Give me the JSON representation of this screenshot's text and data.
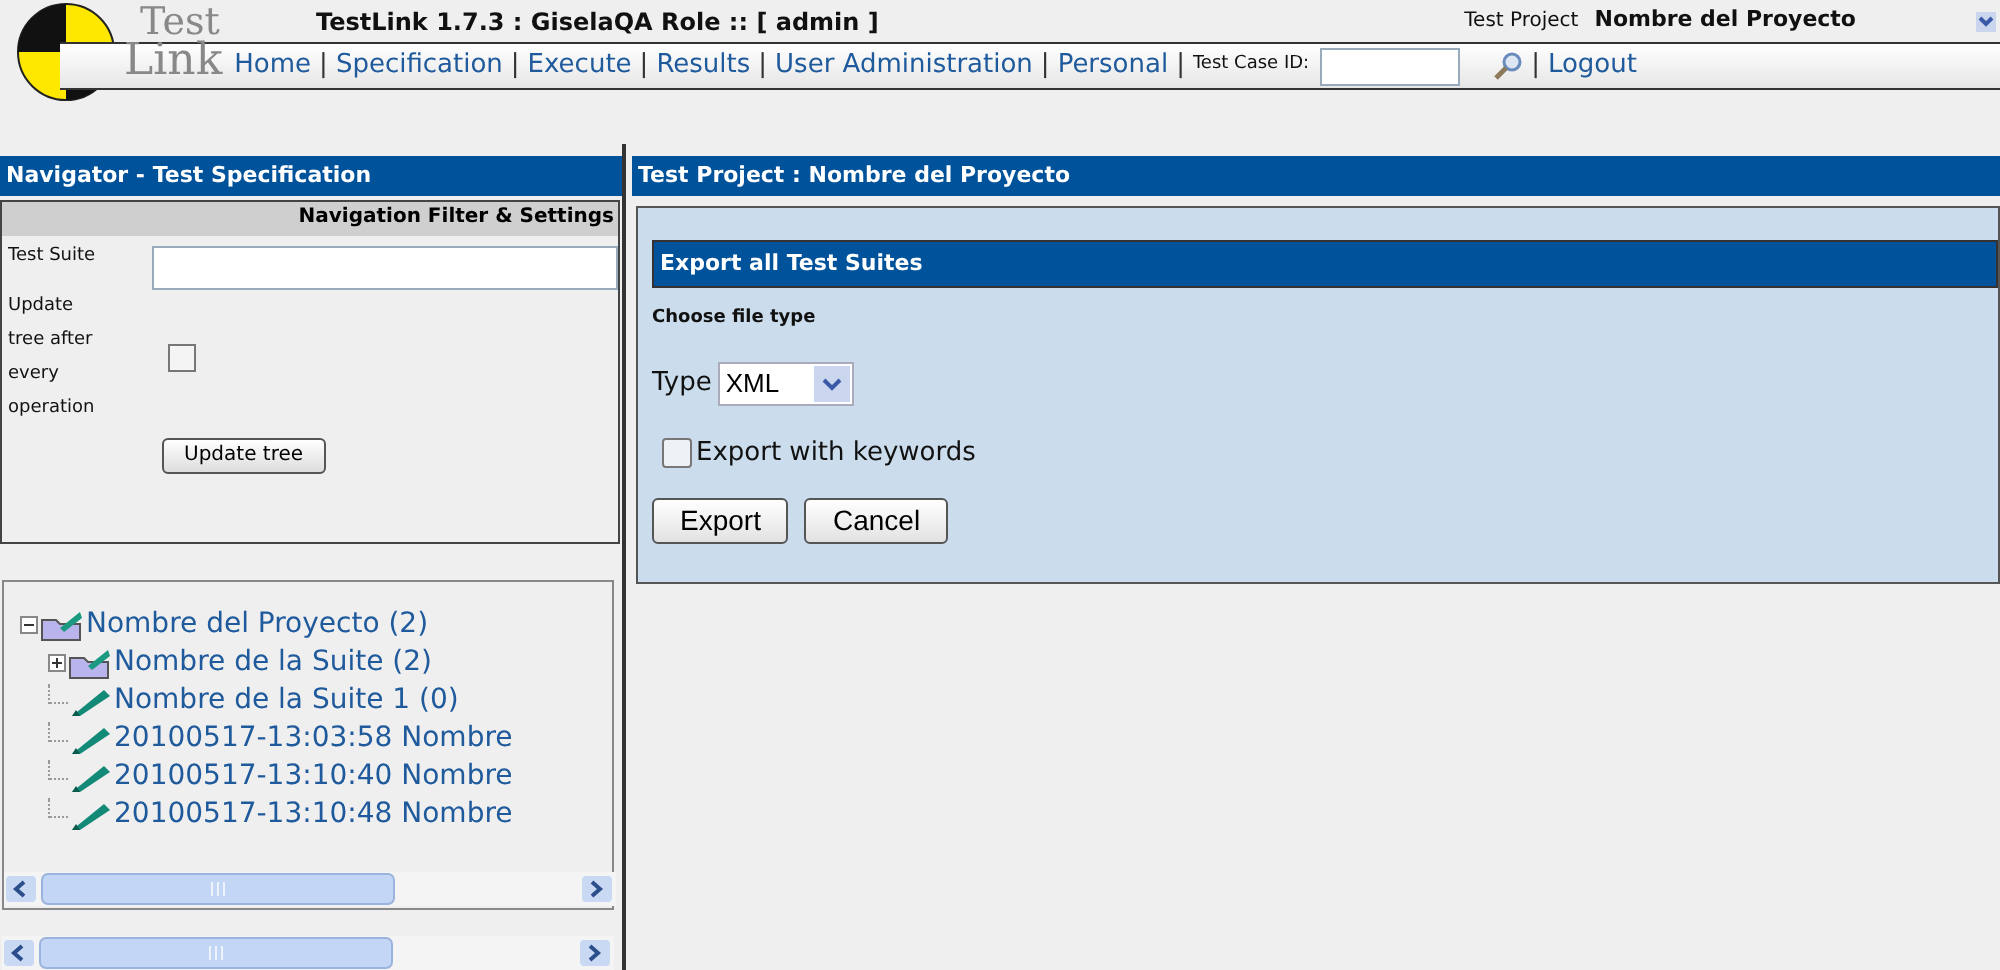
{
  "logo": {
    "top": "Test",
    "bottom": "Link"
  },
  "header": {
    "title": "TestLink 1.7.3 : GiselaQA Role :: [ admin ]",
    "project_label": "Test Project",
    "project_name": "Nombre del Proyecto"
  },
  "nav": [
    {
      "kind": "link",
      "label": "Home"
    },
    {
      "kind": "sep",
      "label": "|"
    },
    {
      "kind": "link",
      "label": "Specification"
    },
    {
      "kind": "sep",
      "label": "|"
    },
    {
      "kind": "link",
      "label": "Execute"
    },
    {
      "kind": "sep",
      "label": "|"
    },
    {
      "kind": "link",
      "label": "Results"
    },
    {
      "kind": "sep",
      "label": "|"
    },
    {
      "kind": "link",
      "label": "User Administration"
    },
    {
      "kind": "sep",
      "label": "|"
    },
    {
      "kind": "link",
      "label": "Personal"
    },
    {
      "kind": "sep",
      "label": "|"
    },
    {
      "kind": "label",
      "label": "Test Case ID:"
    },
    {
      "kind": "field"
    },
    {
      "kind": "search"
    },
    {
      "kind": "sep",
      "label": "|"
    },
    {
      "kind": "link",
      "label": "Logout"
    }
  ],
  "navigator": {
    "title": "Navigator - Test Specification",
    "filter_title": "Navigation Filter & Settings",
    "suite_label": "Test Suite",
    "update_label": "Update tree after every operation",
    "update_checked": false,
    "button": "Update tree",
    "tree": [
      {
        "label": "Nombre del Proyecto (2)",
        "kind": "project",
        "expanded": true,
        "children": [
          {
            "label": "Nombre de la Suite (2)",
            "kind": "suite",
            "expanded": false
          },
          {
            "label": "Nombre de la Suite 1 (0)",
            "kind": "case"
          },
          {
            "label": "20100517-13:03:58 Nombre",
            "kind": "case"
          },
          {
            "label": "20100517-13:10:40 Nombre",
            "kind": "case"
          },
          {
            "label": "20100517-13:10:48 Nombre",
            "kind": "case"
          }
        ]
      }
    ]
  },
  "main": {
    "title": "Test Project : Nombre del Proyecto",
    "section_title": "Export all Test Suites",
    "choose_label": "Choose file type",
    "type_label": "Type",
    "type_value": "XML",
    "keywords_label": "Export with keywords",
    "keywords_checked": false,
    "buttons": [
      "Export",
      "Cancel"
    ]
  }
}
